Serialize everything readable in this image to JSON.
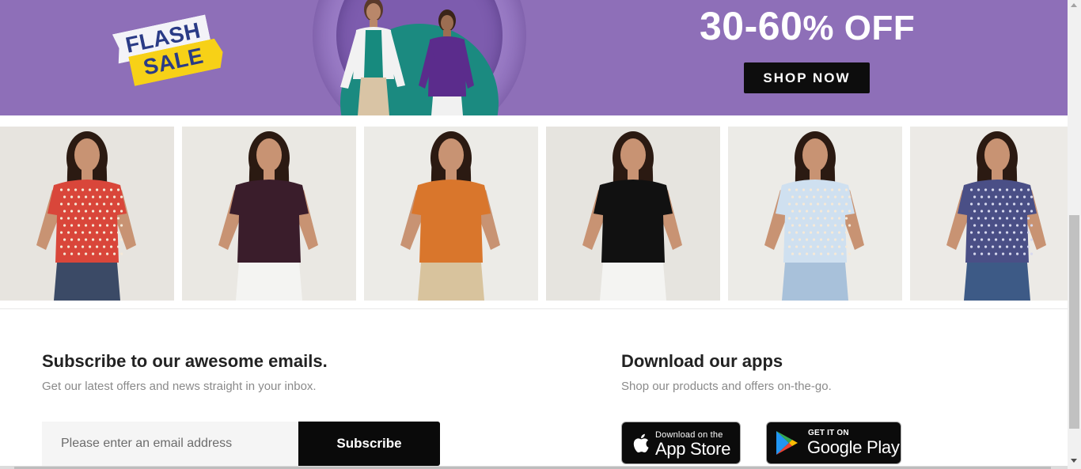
{
  "banner": {
    "flash_line1": "FLASH",
    "flash_line2": "SALE",
    "offer_range": "30-60",
    "offer_percent": "% OFF",
    "shop_now_label": "SHOP NOW",
    "colors": {
      "background": "#8e6fb8",
      "button": "#0d0d0d",
      "flash_yellow": "#f7d117",
      "flash_text": "#2a3b86"
    }
  },
  "products": [
    {
      "name": "red-floral-top",
      "top_color": "#d9463a",
      "pattern": "floral",
      "bottom_color": "#3b4a66",
      "bg": "#e7e4df"
    },
    {
      "name": "plum-tee",
      "top_color": "#3a1d2b",
      "pattern": "solid",
      "bottom_color": "#f4f4f2",
      "bg": "#eae8e3"
    },
    {
      "name": "orange-puff-sleeve-top",
      "top_color": "#d9762c",
      "pattern": "solid",
      "bottom_color": "#d8c39d",
      "bg": "#ecebe7"
    },
    {
      "name": "black-tee",
      "top_color": "#111111",
      "pattern": "solid",
      "bottom_color": "#f4f4f2",
      "bg": "#e6e4df"
    },
    {
      "name": "floral-cami-top",
      "top_color": "#cfe0f0",
      "pattern": "floral",
      "bottom_color": "#a8c1da",
      "bg": "#ecebe7"
    },
    {
      "name": "navy-print-top",
      "top_color": "#4a4f86",
      "pattern": "print",
      "bottom_color": "#3d5a86",
      "bg": "#eceae6"
    }
  ],
  "subscribe": {
    "title": "Subscribe to our awesome emails.",
    "subtitle": "Get our latest offers and news straight in your inbox.",
    "email_placeholder": "Please enter an email address",
    "email_value": "",
    "button_label": "Subscribe"
  },
  "apps": {
    "title": "Download our apps",
    "subtitle": "Shop our products and offers on-the-go.",
    "app_store": {
      "small": "Download on the",
      "big": "App Store",
      "icon": "apple-icon"
    },
    "google_play": {
      "small": "GET IT ON",
      "big": "Google Play",
      "icon": "google-play-icon"
    }
  }
}
